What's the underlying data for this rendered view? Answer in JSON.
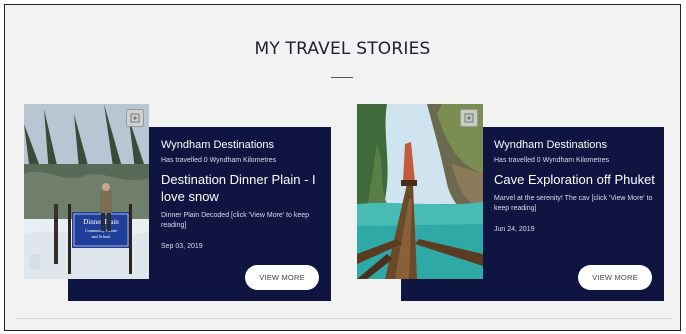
{
  "section": {
    "title": "MY TRAVEL STORIES"
  },
  "stories": [
    {
      "brand": "Wyndham Destinations",
      "subtitle": "Has travelled 0 Wyndham Kilometres",
      "headline": "Destination Dinner Plain - I love snow",
      "description": "Dinner Plain Decoded [click 'View More' to keep reading]",
      "date": "Sep 03, 2019",
      "button_label": "VIEW MORE",
      "photo_sign_text": "Dinner Plain Community Centre and School"
    },
    {
      "brand": "Wyndham Destinations",
      "subtitle": "Has travelled 0 Wyndham Kilometres",
      "headline": "Cave Exploration off Phuket",
      "description": "Marvel at the serenity! The cav [click 'View More' to keep reading]",
      "date": "Jun 24, 2019",
      "button_label": "VIEW MORE"
    }
  ],
  "colors": {
    "card_background": "#0f1440",
    "page_background": "#f2f2f2",
    "button_background": "#ffffff"
  },
  "icons": {
    "photo_corner": "gallery-icon"
  }
}
